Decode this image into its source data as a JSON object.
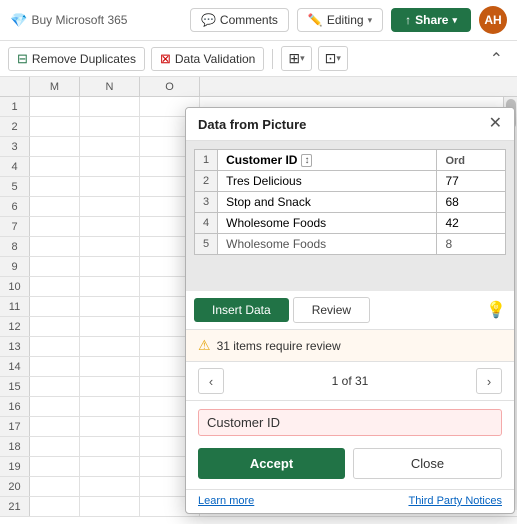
{
  "topbar": {
    "buy_label": "Buy Microsoft 365",
    "comments_label": "Comments",
    "editing_label": "Editing",
    "share_label": "Share",
    "avatar_initials": "AH"
  },
  "ribbon": {
    "remove_duplicates_label": "Remove Duplicates",
    "data_validation_label": "Data Validation"
  },
  "columns": [
    "M",
    "N",
    "O"
  ],
  "rows": [
    {
      "num": "1",
      "m": "",
      "n": "",
      "o": ""
    },
    {
      "num": "2",
      "m": "",
      "n": "",
      "o": ""
    },
    {
      "num": "3",
      "m": "",
      "n": "",
      "o": ""
    },
    {
      "num": "4",
      "m": "",
      "n": "",
      "o": ""
    },
    {
      "num": "5",
      "m": "",
      "n": "",
      "o": ""
    },
    {
      "num": "6",
      "m": "",
      "n": "",
      "o": ""
    },
    {
      "num": "7",
      "m": "",
      "n": "",
      "o": ""
    },
    {
      "num": "8",
      "m": "",
      "n": "",
      "o": ""
    },
    {
      "num": "9",
      "m": "",
      "n": "",
      "o": ""
    },
    {
      "num": "10",
      "m": "",
      "n": "",
      "o": ""
    }
  ],
  "dialog": {
    "title": "Data from Picture",
    "preview": {
      "header_col1": "Customer ID",
      "header_col2": "Ord",
      "rows": [
        {
          "num": "2",
          "col1": "Tres Delicious",
          "col2": "77"
        },
        {
          "num": "3",
          "col1": "Stop and Snack",
          "col2": "68"
        },
        {
          "num": "4",
          "col1": "Wholesome Foods",
          "col2": "42"
        },
        {
          "num": "5",
          "col1": "Wholesome Foods",
          "col2": "8"
        }
      ]
    },
    "tabs": {
      "insert_label": "Insert Data",
      "review_label": "Review"
    },
    "review": {
      "warning_text": "31 items require review",
      "nav_label": "1 of 31",
      "field_value": "Customer ID",
      "field_placeholder": "Customer ID"
    },
    "actions": {
      "accept_label": "Accept",
      "close_label": "Close"
    },
    "footer": {
      "learn_more": "Learn more",
      "third_party": "Third Party Notices"
    }
  }
}
